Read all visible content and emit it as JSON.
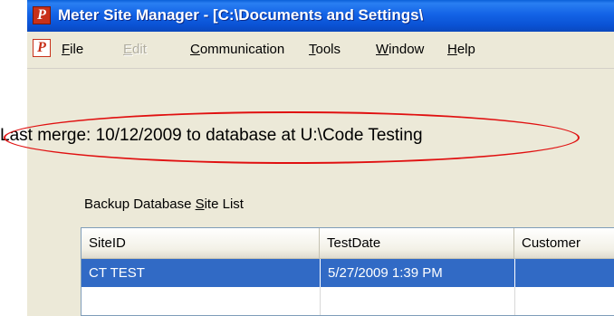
{
  "window": {
    "title": "Meter Site Manager - [C:\\Documents and Settings\\"
  },
  "menu": {
    "items": [
      {
        "label": "File",
        "mnemonic": "F",
        "rest": "ile",
        "enabled": true
      },
      {
        "label": "Edit",
        "mnemonic": "E",
        "rest": "dit",
        "enabled": false
      },
      {
        "label": "Communication",
        "mnemonic": "C",
        "rest": "ommunication",
        "enabled": true
      },
      {
        "label": "Tools",
        "mnemonic": "T",
        "rest": "ools",
        "enabled": true
      },
      {
        "label": "Window",
        "mnemonic": "W",
        "rest": "indow",
        "enabled": true
      },
      {
        "label": "Help",
        "mnemonic": "H",
        "rest": "elp",
        "enabled": true
      }
    ]
  },
  "status": {
    "merge_text": "Last merge: 10/12/2009 to database at U:\\Code Testing"
  },
  "backup": {
    "label_pre": "Backup Database ",
    "label_mnemonic": "S",
    "label_post": "ite List"
  },
  "list": {
    "columns": [
      "SiteID",
      "TestDate",
      "Customer"
    ],
    "rows": [
      {
        "siteid": "CT TEST",
        "testdate": "5/27/2009 1:39 PM",
        "customer": "",
        "selected": true
      }
    ]
  },
  "colors": {
    "titlebar": "#0a52d4",
    "selection": "#316ac5",
    "annotation": "#e01010",
    "window_bg": "#ece9d8"
  },
  "icons": {
    "app_icon": "p-logo-icon"
  }
}
